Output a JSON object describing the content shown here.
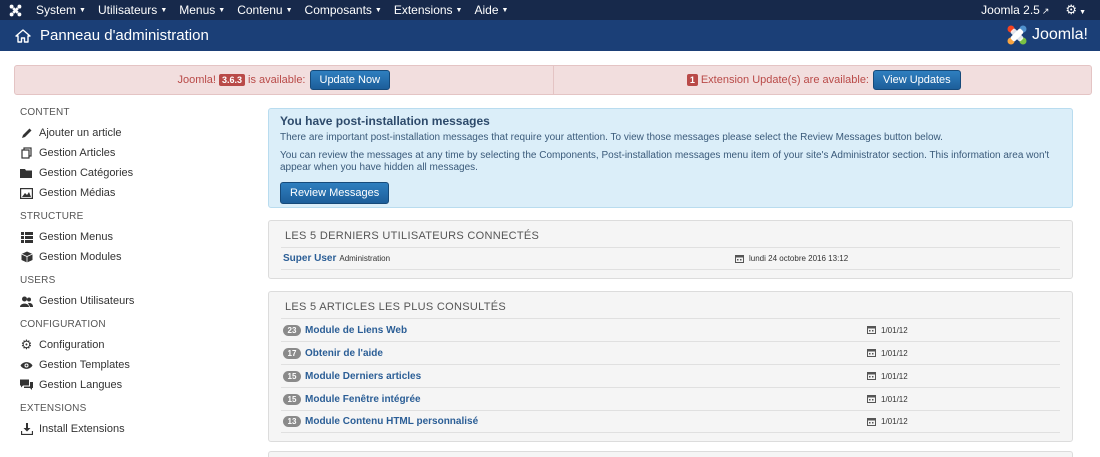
{
  "navbar": {
    "menus": [
      {
        "label": "System"
      },
      {
        "label": "Utilisateurs"
      },
      {
        "label": "Menus"
      },
      {
        "label": "Contenu"
      },
      {
        "label": "Composants"
      },
      {
        "label": "Extensions"
      },
      {
        "label": "Aide"
      }
    ],
    "site_label": "Joomla 2.5"
  },
  "header": {
    "title": "Panneau d'administration",
    "brand": "Joomla!"
  },
  "update_bar": {
    "joomla_prefix": "Joomla!",
    "joomla_version": "3.6.3",
    "joomla_suffix": "is available:",
    "update_now_label": "Update Now",
    "ext_count": "1",
    "ext_text": "Extension Update(s) are available:",
    "view_updates_label": "View Updates"
  },
  "sidebar": {
    "sections": [
      {
        "heading": "CONTENT",
        "items": [
          {
            "label": "Ajouter un article",
            "icon": "pencil-icon"
          },
          {
            "label": "Gestion Articles",
            "icon": "copy-icon"
          },
          {
            "label": "Gestion Catégories",
            "icon": "folder-icon"
          },
          {
            "label": "Gestion Médias",
            "icon": "image-icon"
          }
        ]
      },
      {
        "heading": "STRUCTURE",
        "items": [
          {
            "label": "Gestion Menus",
            "icon": "list-icon"
          },
          {
            "label": "Gestion Modules",
            "icon": "cube-icon"
          }
        ]
      },
      {
        "heading": "USERS",
        "items": [
          {
            "label": "Gestion Utilisateurs",
            "icon": "users-icon"
          }
        ]
      },
      {
        "heading": "CONFIGURATION",
        "items": [
          {
            "label": "Configuration",
            "icon": "cog-icon"
          },
          {
            "label": "Gestion Templates",
            "icon": "eye-icon"
          },
          {
            "label": "Gestion Langues",
            "icon": "comments-icon"
          }
        ]
      },
      {
        "heading": "EXTENSIONS",
        "items": [
          {
            "label": "Install Extensions",
            "icon": "download-icon"
          }
        ]
      }
    ]
  },
  "postinstall": {
    "title": "You have post-installation messages",
    "p1": "There are important post-installation messages that require your attention. To view those messages please select the Review Messages button below.",
    "p2": "You can review the messages at any time by selecting the Components, Post-installation messages menu item of your site's Administrator section. This information area won't appear when you have hidden all messages.",
    "button": "Review Messages"
  },
  "logged_users": {
    "title": "LES 5 DERNIERS UTILISATEURS CONNECTÉS",
    "rows": [
      {
        "name": "Super User",
        "role": "Administration",
        "date": "lundi 24 octobre 2016 13:12"
      }
    ]
  },
  "popular_articles": {
    "title": "LES 5 ARTICLES LES PLUS CONSULTÉS",
    "rows": [
      {
        "hits": "23",
        "title": "Module de Liens Web",
        "date": "1/01/12"
      },
      {
        "hits": "17",
        "title": "Obtenir de l'aide",
        "date": "1/01/12"
      },
      {
        "hits": "15",
        "title": "Module Derniers articles",
        "date": "1/01/12"
      },
      {
        "hits": "15",
        "title": "Module Fenêtre intégrée",
        "date": "1/01/12"
      },
      {
        "hits": "13",
        "title": "Module Contenu HTML personnalisé",
        "date": "1/01/12"
      }
    ]
  }
}
